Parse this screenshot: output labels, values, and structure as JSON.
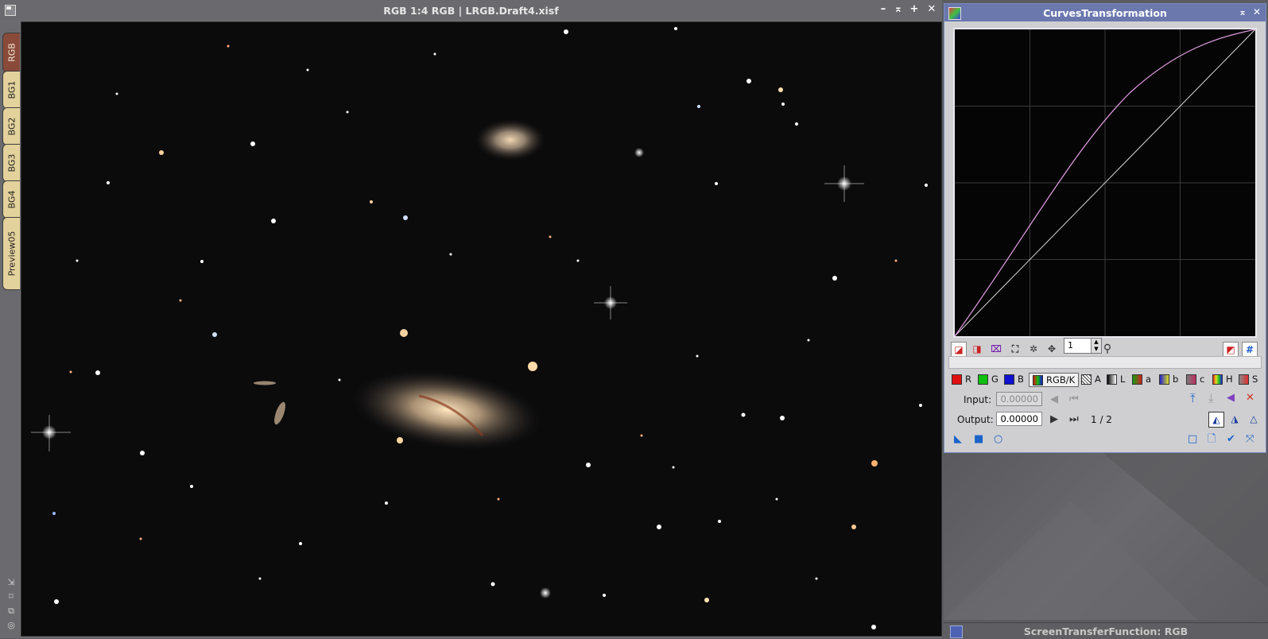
{
  "image_window": {
    "title": "RGB 1:4 RGB | LRGB.Draft4.xisf",
    "buttons": {
      "minimize": "–",
      "shade": "⌅",
      "maximize": "+",
      "close": "✕"
    },
    "tabs": [
      "RGB",
      "BG1",
      "BG2",
      "BG3",
      "BG4",
      "Preview05"
    ],
    "active_tab": "RGB"
  },
  "curves": {
    "title": "CurvesTransformation",
    "zoom_value": "1",
    "channels": [
      "R",
      "G",
      "B",
      "RGB/K",
      "A",
      "L",
      "a",
      "b",
      "c",
      "H",
      "S"
    ],
    "selected_channel": "RGB/K",
    "channel_colors": {
      "R": "#e01010",
      "G": "#10c010",
      "B": "#1010d0"
    },
    "input_label": "Input:",
    "input_value": "0.00000",
    "output_label": "Output:",
    "output_value": "0.00000",
    "point_counter": "1 / 2",
    "curve_color": "#e6a0e6",
    "identity_color": "#e0e0e0"
  },
  "stf": {
    "title": "ScreenTransferFunction: RGB"
  },
  "icons": {
    "window": "window-icon",
    "curves": "curves-icon",
    "zoom": "zoom-icon",
    "delete": "delete-icon"
  }
}
